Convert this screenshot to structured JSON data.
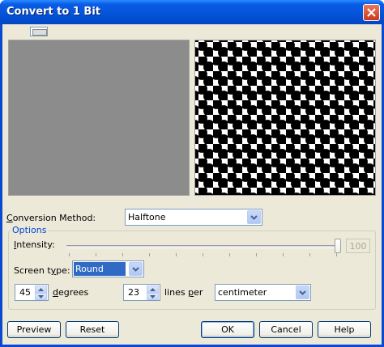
{
  "window": {
    "title": "Convert to 1 Bit"
  },
  "conversion": {
    "label_prefix": "C",
    "label_rest": "onversion Method:",
    "value": "Halftone"
  },
  "options": {
    "group_title": "Options",
    "intensity_prefix": "I",
    "intensity_rest": "ntensity:",
    "intensity_value": "100",
    "screen_type_label_1": "Screen t",
    "screen_type_label_u": "y",
    "screen_type_label_2": "pe:",
    "screen_type_value": "Round",
    "degrees_value": "45",
    "degrees_prefix": "d",
    "degrees_rest": "egrees",
    "lines_value": "23",
    "lines_label_1": "lines ",
    "lines_label_u": "p",
    "lines_label_2": "er",
    "unit_value": "centimeter"
  },
  "buttons": {
    "preview": "Preview",
    "reset": "Reset",
    "ok": "OK",
    "cancel": "Cancel",
    "help": "Help"
  },
  "colors": {
    "titlebar": "#0453d8",
    "face": "#ece9d8",
    "selection": "#316ac5",
    "group_title": "#0046d5"
  }
}
